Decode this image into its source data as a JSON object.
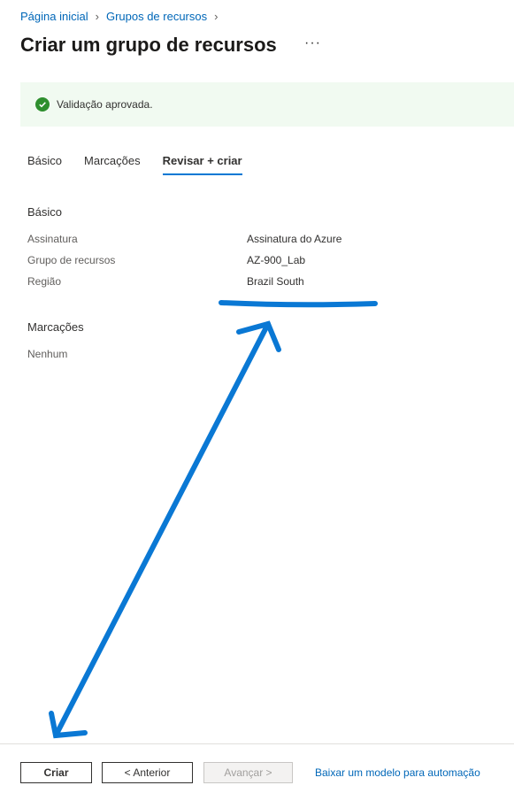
{
  "breadcrumb": {
    "home": "Página inicial",
    "resource_groups": "Grupos de recursos"
  },
  "page": {
    "title": "Criar um grupo de recursos",
    "more": "···"
  },
  "banner": {
    "text": "Validação aprovada.",
    "icon": "check-circle-icon"
  },
  "tabs": [
    {
      "label": "Básico"
    },
    {
      "label": "Marcações"
    },
    {
      "label": "Revisar + criar",
      "active": true
    }
  ],
  "basics": {
    "title": "Básico",
    "rows": [
      {
        "label": "Assinatura",
        "value": "Assinatura do Azure"
      },
      {
        "label": "Grupo de recursos",
        "value": "AZ-900_Lab"
      },
      {
        "label": "Região",
        "value": "Brazil South"
      }
    ]
  },
  "tags": {
    "title": "Marcações",
    "value": "Nenhum"
  },
  "footer": {
    "create_label": "Criar",
    "prev_label": "< Anterior",
    "next_label": "Avançar >",
    "download_link": "Baixar um modelo para automação"
  },
  "colors": {
    "accent": "#0078d4",
    "link": "#0067b8",
    "success": "#2e8f2e",
    "annotation": "#0a78d4"
  }
}
